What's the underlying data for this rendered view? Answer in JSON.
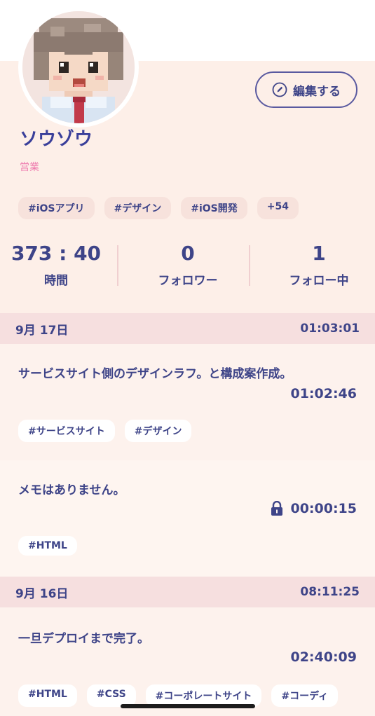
{
  "profile": {
    "name": "ソウゾウ",
    "role": "営業",
    "edit_label": "編集する",
    "tags": [
      "#iOSアプリ",
      "#デザイン",
      "#iOS開発",
      "+54"
    ],
    "stats": [
      {
        "value": "373 : 40",
        "label": "時間"
      },
      {
        "value": "0",
        "label": "フォロワー"
      },
      {
        "value": "1",
        "label": "フォロー中"
      }
    ]
  },
  "days": [
    {
      "date": "9月 17日",
      "total": "01:03:01",
      "entries": [
        {
          "memo": "サービスサイト側のデザインラフ。と構成案作成。",
          "time": "01:02:46",
          "locked": false,
          "tags": [
            "#サービスサイト",
            "#デザイン"
          ]
        },
        {
          "memo": "メモはありません。",
          "time": "00:00:15",
          "locked": true,
          "tags": [
            "#HTML"
          ]
        }
      ]
    },
    {
      "date": "9月 16日",
      "total": "08:11:25",
      "entries": [
        {
          "memo": "一旦デプロイまで完了。",
          "time": "02:40:09",
          "locked": false,
          "tags": [
            "#HTML",
            "#CSS",
            "#コーポレートサイト",
            "#コーディ"
          ]
        }
      ]
    }
  ],
  "colors": {
    "accent": "#3e4488",
    "role": "#ee7eb0",
    "date_bar": "#f6dfdf",
    "profile_bg": "#fdefe8"
  },
  "icons": {
    "edit": "pencil-circle-icon",
    "lock": "lock-icon"
  }
}
